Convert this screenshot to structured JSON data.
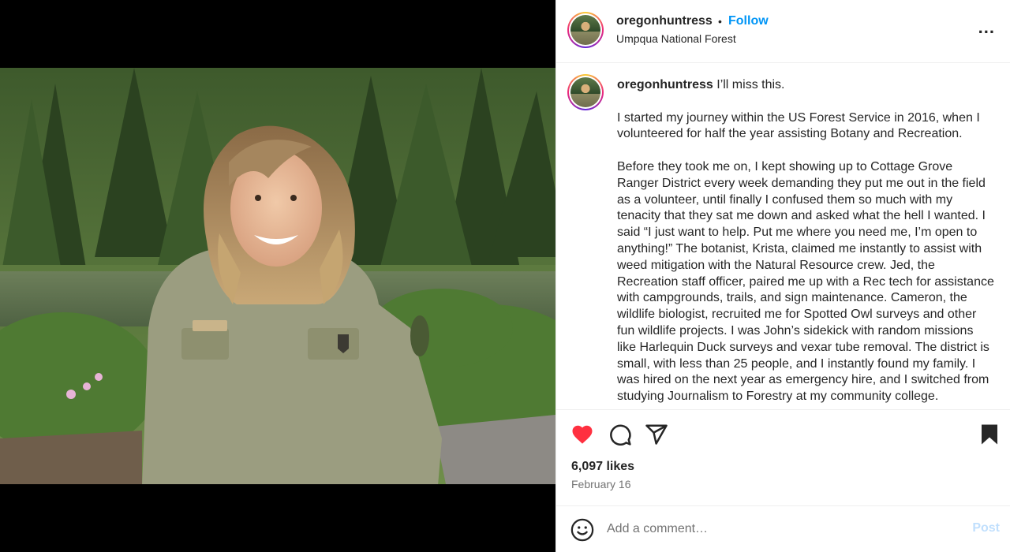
{
  "post": {
    "username": "oregonhuntress",
    "separator": "•",
    "follow_label": "Follow",
    "location": "Umpqua National Forest",
    "more_label": "..."
  },
  "caption": {
    "username": "oregonhuntress",
    "first_line": "I’ll miss this.",
    "paragraph_1": "I started my journey within the US Forest Service in 2016, when I volunteered for half the year assisting Botany and Recreation.",
    "paragraph_2": "Before they took me on, I kept showing up to Cottage Grove Ranger District every week demanding they put me out in the field as a volunteer, until finally I confused them so much with my tenacity that they sat me down and asked what the hell I wanted. I said “I just want to help. Put me where you need me, I’m open to anything!” The botanist, Krista, claimed me instantly to assist with weed mitigation with the Natural Resource crew. Jed, the Recreation staff officer, paired me up with a Rec tech for assistance with campgrounds, trails, and sign maintenance. Cameron, the wildlife biologist, recruited me for Spotted Owl surveys and other fun wildlife projects. I was John’s sidekick with random missions like Harlequin Duck surveys and vexar tube removal. The district is small, with less than 25 people, and I instantly found my family. I was hired on the next year as emergency hire, and I switched from studying Journalism to Forestry at my community college."
  },
  "engagement": {
    "likes": "6,097 likes",
    "date": "February 16"
  },
  "comment_box": {
    "placeholder": "Add a comment…",
    "post_label": "Post"
  },
  "icons": {
    "like": "heart-filled-icon",
    "comment": "comment-bubble-icon",
    "share": "paper-plane-icon",
    "save": "bookmark-filled-icon",
    "emoji": "smiley-icon"
  },
  "colors": {
    "like_red": "#ff3040",
    "follow_blue": "#0095f6",
    "post_disabled": "#c0dffd",
    "secondary_text": "#737373"
  }
}
